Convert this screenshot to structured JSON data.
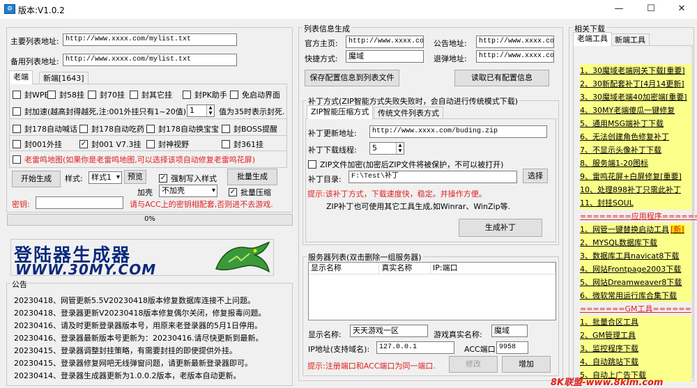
{
  "window": {
    "title": "版本:V1.0.2",
    "min": "—",
    "max": "☐",
    "close": "✕"
  },
  "left": {
    "main_url_label": "主要列表地址:",
    "main_url_value": "http://www.xxxx.com/mylist.txt",
    "backup_url_label": "备用列表地址:",
    "backup_url_value": "http://www.xxxx.com/mylist.txt",
    "tabs": [
      "老端",
      "新端[1643]"
    ],
    "row1": [
      "封WPE",
      "封58挂",
      "封70挂",
      "封其它挂",
      "封PK助手",
      "免启动界面"
    ],
    "speed_label": "封加速(越高封得越死,注:001外挂只有1~20值)",
    "speed_value": "1",
    "speed_hint": "值为35时表示封死.",
    "row3": [
      "封178自动喊话",
      "封178自动吃药",
      "封178自动换宝宝",
      "封BOSS提醒"
    ],
    "row4": [
      "封001外挂",
      "封001 V7.3挂",
      "封神视野",
      "封361挂"
    ],
    "row4_checked": [
      false,
      true,
      false,
      false
    ],
    "map_label": "老雷鸣地图(如果你是老雷鸣地图,可以选择该项自动修复老雷鸣花屏)",
    "start_btn": "开始生成",
    "style_label": "样式:",
    "style_value": "样式1",
    "preview_btn": "预览",
    "force_write": "强制写入样式",
    "batch_btn": "批量生成",
    "shell_label": "加壳",
    "shell_value": "不加壳",
    "batch_compress": "批量压缩",
    "key_label": "密钥:",
    "key_hint": "请与ACC上的密钥相配套,否则进不去游戏.",
    "progress_text": "0%",
    "progress_value": 0,
    "banner_line1": "登陆器生成器",
    "banner_line2": "WWW.30MY.COM",
    "notice_title": "公告",
    "notices": [
      "20230418、网管更新5.5V20230418版本修复数据库连接不上问题。",
      "20230418、登录器更新V20230418版本修复偶尔关闭，修复报毒问题。",
      "20230416、请及时更新登录器版本号，用原来老登录器的5月1日停用。",
      "20230416、登录器最新版本号更新为：20230416.请尽快更新到最新。",
      "20230415、登录器调整封挂策略，有需要封挂的即使提供外挂。",
      "20230415、登录器修复网吧无线弹窗问题，请更新最新登录器即可。",
      "20230414、登录器生成器更新为1.0.0.2版本，老版本自动更新。"
    ]
  },
  "mid": {
    "group_title": "列表信息生成",
    "home_label": "官方主页:",
    "home_value": "http://www.xxxx.com",
    "notice_label": "公告地址:",
    "notice_value": "http://www.xxxx.com",
    "shortcut_label": "快捷方式:",
    "shortcut_value": "魔域",
    "refund_label": "退弹地址:",
    "refund_value": "http://www.xxxx.com",
    "save_btn": "保存配置信息到列表文件",
    "read_btn": "读取已有配置信息",
    "patch_group": "补丁方式(ZIP智能方式失败失败时，会自动进行传统模式下载)",
    "patch_tabs": [
      "ZIP智能压缩方式",
      "传统文件列表方式"
    ],
    "patch_url_label": "补丁更新地址:",
    "patch_url_value": "http://www.xxxx.com/buding.zip",
    "patch_threads_label": "补丁下载线程:",
    "patch_threads_value": "5",
    "zip_encrypt": "ZIP文件加密(加密后ZIP文件将被保护，不可以被打开)",
    "patch_dir_label": "补丁目录:",
    "patch_dir_value": "F:\\Test\\补丁",
    "choose_btn": "选择",
    "tip1": "提示:该补丁方式，下载速度快，稳定。并操作方便。",
    "tip2": "ZIP补丁也可使用其它工具生成,如Winrar、WinZip等.",
    "gen_patch_btn": "生成补丁",
    "server_group": "服务器列表(双击删除一组服务器)",
    "cols": [
      "显示名称",
      "真实名称",
      "IP:端口"
    ],
    "display_name_label": "显示名称:",
    "display_name_value": "天天游戏一区",
    "real_name_label": "游戏真实名称:",
    "real_name_value": "魔域",
    "ip_label": "IP地址(支持域名):",
    "ip_value": "127.0.0.1",
    "acc_port_label": "ACC端口:",
    "acc_port_value": "9958",
    "port_tip": "提示:注册端口和ACC端口为同一端口.",
    "modify_btn": "修改",
    "add_btn": "增加"
  },
  "right": {
    "group_title": "相关下载",
    "tabs": [
      "老端工具",
      "新端工具"
    ],
    "items": [
      {
        "type": "link",
        "text": "1、30魔域老端网关下载[重要]"
      },
      {
        "type": "link",
        "text": "2、30新配套补丁[4月14更新]"
      },
      {
        "type": "link",
        "text": "3、30魔域老端40加密端[重要]"
      },
      {
        "type": "link",
        "text": "4、30MY老端傻瓜一键修复"
      },
      {
        "type": "link",
        "text": "5、通用MSG端补丁下载"
      },
      {
        "type": "link",
        "text": "6、无法创建角色修复补丁"
      },
      {
        "type": "link",
        "text": "7、不显示头像补丁下载"
      },
      {
        "type": "link",
        "text": "8、服务端1-20图标"
      },
      {
        "type": "link",
        "text": "9、雷鸣花屏+白屏修复[重要]"
      },
      {
        "type": "link",
        "text": "10、处理898补丁只需此补丁"
      },
      {
        "type": "link",
        "text": "11、封挂SOUL"
      },
      {
        "type": "sep",
        "text": "========应用程序======"
      },
      {
        "type": "link",
        "text": "1、网管一键替换启动工具",
        "badge": "[新]"
      },
      {
        "type": "link",
        "text": "2、MYSQL数据库下载"
      },
      {
        "type": "link",
        "text": "3、数据库工具navicat8下载"
      },
      {
        "type": "link",
        "text": "4、网站Frontpage2003下载"
      },
      {
        "type": "link",
        "text": "5、网站Dreamweaver8下载"
      },
      {
        "type": "link",
        "text": "6、微软常用运行库合集下载"
      },
      {
        "type": "sep",
        "text": "=======GM工具======"
      },
      {
        "type": "link",
        "text": "1、批量合区工具"
      },
      {
        "type": "link",
        "text": "2、GM管理工具"
      },
      {
        "type": "link",
        "text": "3、监控程序下载"
      },
      {
        "type": "link",
        "text": "4、自动跳站下载"
      },
      {
        "type": "link",
        "text": "5、自动上广告下载"
      }
    ],
    "watermark": "8K联盟-www.8klm.com"
  }
}
